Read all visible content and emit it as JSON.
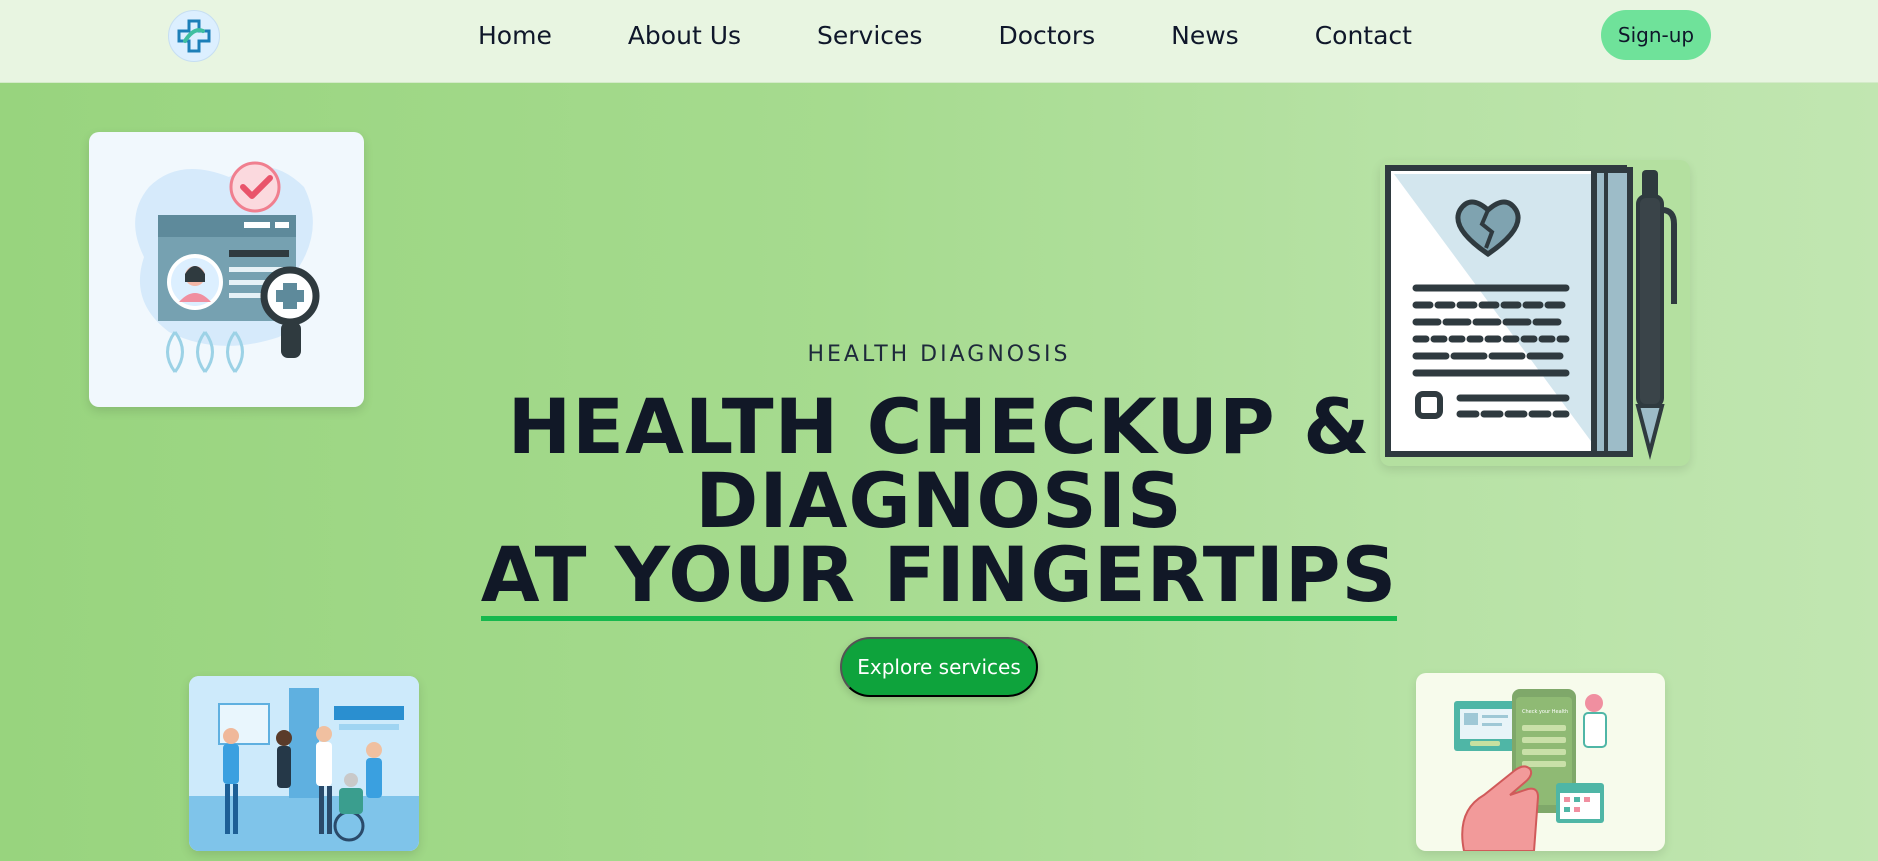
{
  "nav": {
    "logo_icon": "medical-cross-logo-icon",
    "links": [
      {
        "label": "Home"
      },
      {
        "label": "About Us"
      },
      {
        "label": "Services"
      },
      {
        "label": "Doctors"
      },
      {
        "label": "News"
      },
      {
        "label": "Contact"
      }
    ],
    "signup_label": "Sign-up"
  },
  "hero": {
    "eyebrow": "HEALTH DIAGNOSIS",
    "headline_line1": "HEALTH CHECKUP &",
    "headline_line2": "DIAGNOSIS",
    "headline_line3": "AT YOUR FINGERTIPS",
    "cta_label": "Explore services"
  },
  "illustrations": {
    "top_left": "patient-id-card-illustration",
    "top_right": "medical-report-with-pen-illustration",
    "bottom_left": "hospital-waiting-room-illustration",
    "bottom_right": "mobile-health-app-illustration",
    "app_screen_text": "Check your Health"
  },
  "colors": {
    "nav_bg": "#e8f5e1",
    "hero_bg": "#a6db8f",
    "signup_bg": "#6fe29a",
    "cta_bg": "#0ea33c",
    "underline": "#16b84d"
  }
}
